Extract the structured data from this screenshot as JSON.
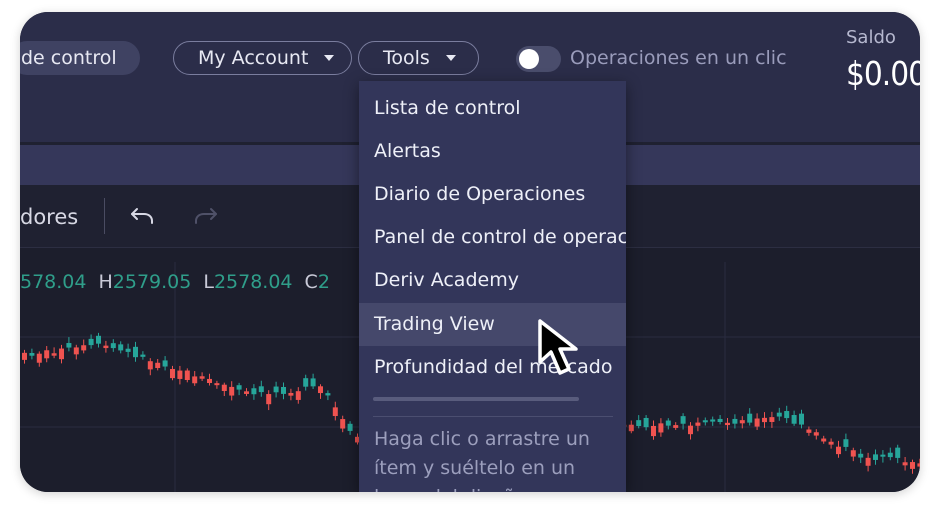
{
  "header": {
    "tab_partial": "de control",
    "my_account_label": "My Account",
    "tools_label": "Tools",
    "one_click_label": "Operaciones en un clic",
    "balance_label": "Saldo",
    "balance_value": "$0.00"
  },
  "chart_toolbar": {
    "indicators_partial": "dores"
  },
  "ohlc": {
    "open_partial": "578.04",
    "high_key": "H",
    "high_value": "2579.05",
    "low_key": "L",
    "low_value": "2578.04",
    "close_key": "C",
    "close_partial": "2"
  },
  "tools_menu": {
    "items": [
      {
        "label": "Lista de control"
      },
      {
        "label": "Alertas"
      },
      {
        "label": "Diario de Operaciones"
      },
      {
        "label": "Panel de control de operac"
      },
      {
        "label": "Deriv Academy"
      },
      {
        "label": "Trading View"
      },
      {
        "label": "Profundidad del mercado"
      }
    ],
    "hint": "Haga clic o arrastre un ítem y suéltelo en un lugar del diseño"
  },
  "colors": {
    "up_candle": "#26a69a",
    "down_candle": "#ef5350",
    "background": "#1f2131",
    "menu_background": "#33365a"
  }
}
